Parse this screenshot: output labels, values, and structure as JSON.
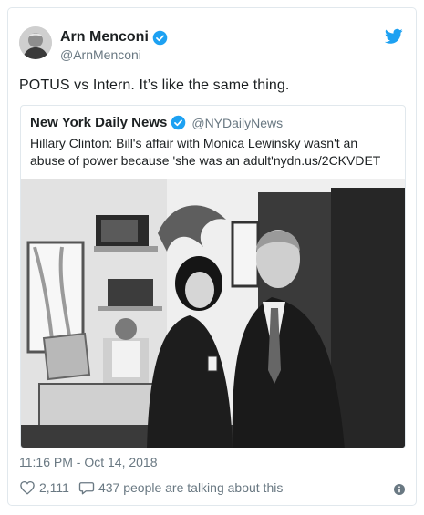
{
  "tweet": {
    "author_name": "Arn Menconi",
    "author_handle": "@ArnMenconi",
    "text": "POTUS vs Intern. It’s like the same thing.",
    "timestamp": "11:16 PM - Oct 14, 2018",
    "likes": "2,111",
    "talking": "437 people are talking about this"
  },
  "quoted": {
    "author_name": "New York Daily News",
    "author_handle": "@NYDailyNews",
    "text": "Hillary Clinton: Bill's affair with Monica Lewinsky wasn't an abuse of power because 'she was an adult'nydn.us/2CKVDET"
  },
  "icons": {
    "verified": "verified-badge-icon",
    "twitter": "twitter-bird-icon",
    "like": "heart-icon",
    "reply": "speech-bubble-icon",
    "info": "info-icon"
  },
  "colors": {
    "verified": "#1da1f2",
    "twitter": "#1da1f2",
    "secondary_text": "#697882",
    "border": "#e1e8ed"
  }
}
